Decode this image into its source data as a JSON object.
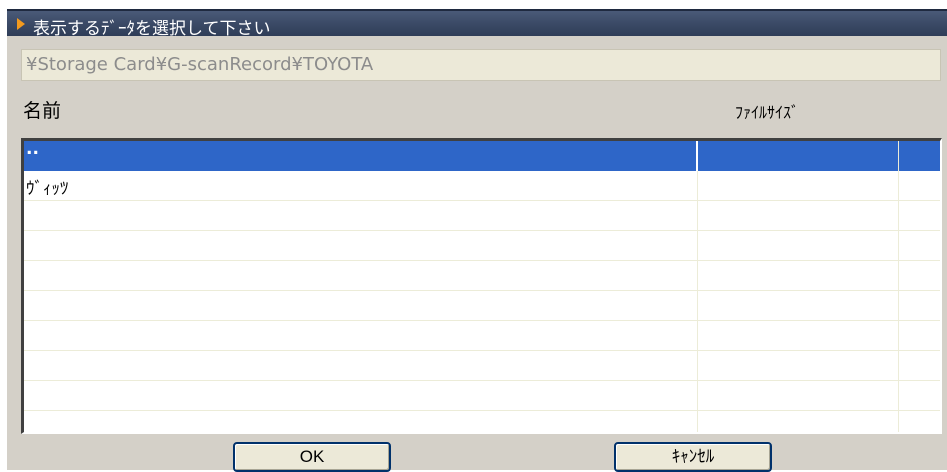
{
  "window": {
    "title": "表示するﾃﾞｰﾀを選択して下さい"
  },
  "path": {
    "value": "¥Storage Card¥G-scanRecord¥TOYOTA"
  },
  "list": {
    "columns": [
      "名前",
      "ﾌｧｲﾙｻｲｽﾞ"
    ],
    "rows": [
      {
        "name": "..",
        "size": "",
        "selected": true
      },
      {
        "name": "ｳﾞｨｯﾂ",
        "size": "",
        "selected": false
      }
    ],
    "empty_rows": 8
  },
  "buttons": {
    "ok": "OK",
    "cancel": "ｷｬﾝｾﾙ"
  },
  "colors": {
    "titlebar": "#3b4a66",
    "title_arrow": "#f39a1e",
    "selection": "#2e66c8",
    "dialog_bg": "#d4d0c8"
  },
  "icons": {
    "title": "play-arrow-icon"
  }
}
